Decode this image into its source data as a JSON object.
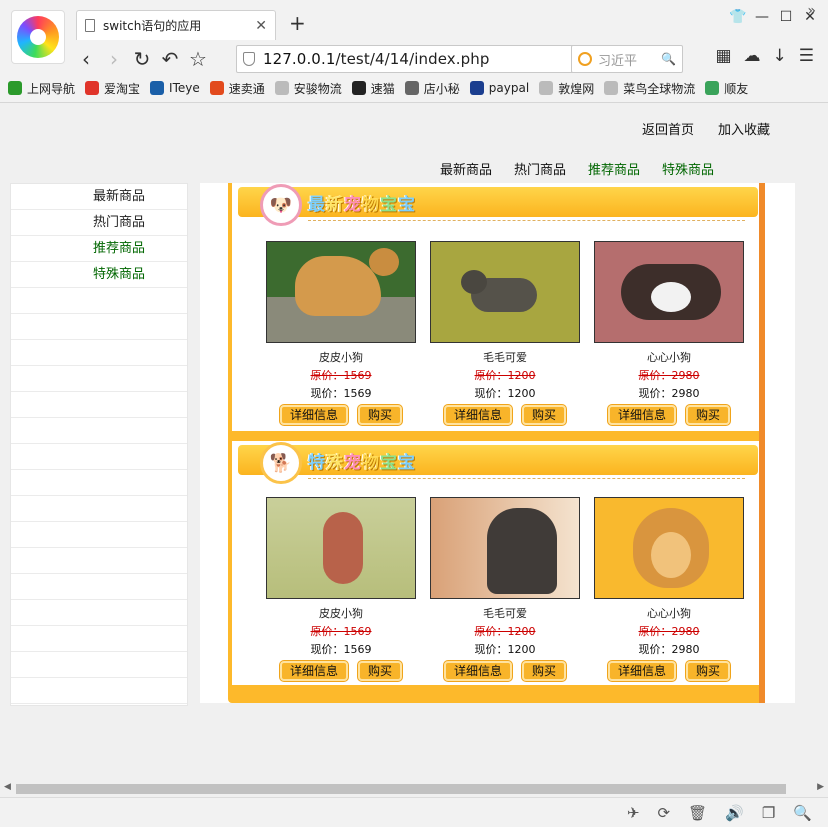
{
  "browser": {
    "tab_title": "switch语句的应用",
    "tab_close": "✕",
    "new_tab": "+",
    "window_controls": [
      "👕",
      "—",
      "☐",
      "✕"
    ],
    "nav_icons": [
      "‹",
      "›",
      "↻",
      "↶",
      "☆"
    ],
    "url_host": "127.0.0.1",
    "url_path": "/test/4/14/index.php",
    "url_icons": [
      "⚡",
      "☆",
      "⌄"
    ],
    "search_text": "习近平",
    "right_icons": [
      "▦",
      "☁",
      "↓",
      "☰"
    ],
    "bookmarks": [
      {
        "label": "上网导航",
        "color": "#2b9a2b"
      },
      {
        "label": "爱淘宝",
        "color": "#e0342a"
      },
      {
        "label": "ITeye",
        "color": "#1a5fa8"
      },
      {
        "label": "速卖通",
        "color": "#e24a1d"
      },
      {
        "label": "安骏物流",
        "color": "#bbbbbb"
      },
      {
        "label": "速猫",
        "color": "#222222"
      },
      {
        "label": "店小秘",
        "color": "#666666"
      },
      {
        "label": "paypal",
        "color": "#1b3e8f"
      },
      {
        "label": "敦煌网",
        "color": "#bbbbbb"
      },
      {
        "label": "菜鸟全球物流",
        "color": "#bbbbbb"
      },
      {
        "label": "顺友",
        "color": "#3aa35a"
      }
    ],
    "bookmarks_more": "»",
    "status_icons": [
      "✈",
      "⟳",
      "🗑",
      "🔊",
      "❐",
      "🔍"
    ]
  },
  "page": {
    "top_links": [
      "返回首页",
      "加入收藏"
    ],
    "main_nav": [
      {
        "label": "最新商品",
        "green": false
      },
      {
        "label": "热门商品",
        "green": false
      },
      {
        "label": "推荐商品",
        "green": true
      },
      {
        "label": "特殊商品",
        "green": true
      }
    ],
    "sidebar": [
      {
        "label": "最新商品",
        "green": false
      },
      {
        "label": "热门商品",
        "green": false
      },
      {
        "label": "推荐商品",
        "green": true
      },
      {
        "label": "特殊商品",
        "green": true
      },
      {
        "label": ""
      },
      {
        "label": ""
      },
      {
        "label": ""
      },
      {
        "label": ""
      },
      {
        "label": ""
      },
      {
        "label": ""
      },
      {
        "label": ""
      },
      {
        "label": ""
      },
      {
        "label": ""
      },
      {
        "label": ""
      },
      {
        "label": ""
      },
      {
        "label": ""
      },
      {
        "label": ""
      },
      {
        "label": ""
      },
      {
        "label": ""
      },
      {
        "label": ""
      }
    ],
    "section1": {
      "title_chars": [
        "最",
        "新",
        "宠",
        "物",
        "宝",
        "宝"
      ],
      "badge_icon": "🐶",
      "products": [
        {
          "name": "皮皮小狗",
          "orig": "原价：1569",
          "now": "现价：1569",
          "img": "p1"
        },
        {
          "name": "毛毛可爱",
          "orig": "原价：1200",
          "now": "现价：1200",
          "img": "p2"
        },
        {
          "name": "心心小狗",
          "orig": "原价：2980",
          "now": "现价：2980",
          "img": "p3"
        }
      ]
    },
    "section2": {
      "title_chars": [
        "特",
        "殊",
        "宠",
        "物",
        "宝",
        "宝"
      ],
      "badge_icon": "🐕",
      "products": [
        {
          "name": "皮皮小狗",
          "orig": "原价：1569",
          "now": "现价：1569",
          "img": "p4"
        },
        {
          "name": "毛毛可爱",
          "orig": "原价：1200",
          "now": "现价：1200",
          "img": "p5"
        },
        {
          "name": "心心小狗",
          "orig": "原价：2980",
          "now": "现价：2980",
          "img": "p6"
        }
      ]
    },
    "detail_label": "详细信息",
    "buy_label": "购买"
  }
}
